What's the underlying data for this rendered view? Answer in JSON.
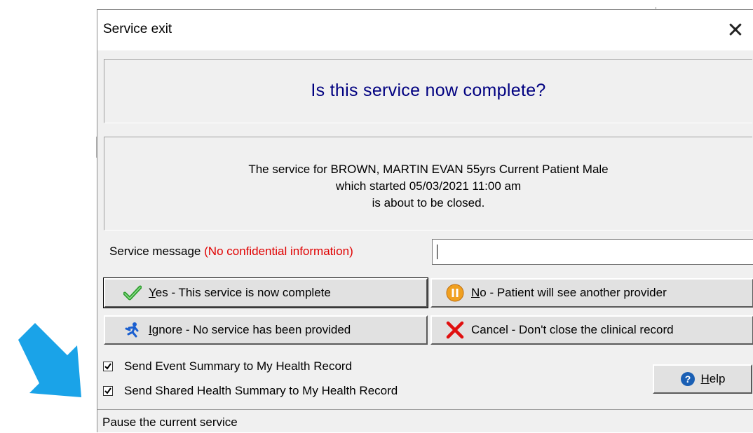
{
  "window": {
    "title": "Service exit",
    "close_symbol": "✕"
  },
  "question": "Is this service now complete?",
  "info": {
    "line1": "The service for BROWN, MARTIN EVAN 55yrs Current Patient Male",
    "line2": "which started 05/03/2021 11:00 am",
    "line3": "is about to be closed."
  },
  "service_message": {
    "label": "Service message",
    "warning": "(No confidential information)",
    "value": ""
  },
  "buttons": {
    "yes": {
      "accel": "Y",
      "rest": "es - This service is now complete",
      "icon": "check-icon"
    },
    "no": {
      "accel": "N",
      "rest": "o - Patient will see another provider",
      "icon": "pause-icon"
    },
    "ignore": {
      "accel": "I",
      "rest": "gnore - No service has been provided",
      "icon": "running-person-icon"
    },
    "cancel": {
      "label": "Cancel - Don't close the clinical record",
      "icon": "red-x-icon"
    },
    "help": {
      "accel": "H",
      "rest": "elp",
      "icon": "help-icon"
    }
  },
  "checkboxes": [
    {
      "label": "Send Event Summary to My Health Record",
      "checked": true
    },
    {
      "label": "Send Shared Health Summary to My Health Record",
      "checked": true
    }
  ],
  "status_bar": "Pause the current service",
  "colors": {
    "accent_blue": "#000080",
    "warning_red": "#e00000",
    "arrow": "#1aa3e8"
  }
}
